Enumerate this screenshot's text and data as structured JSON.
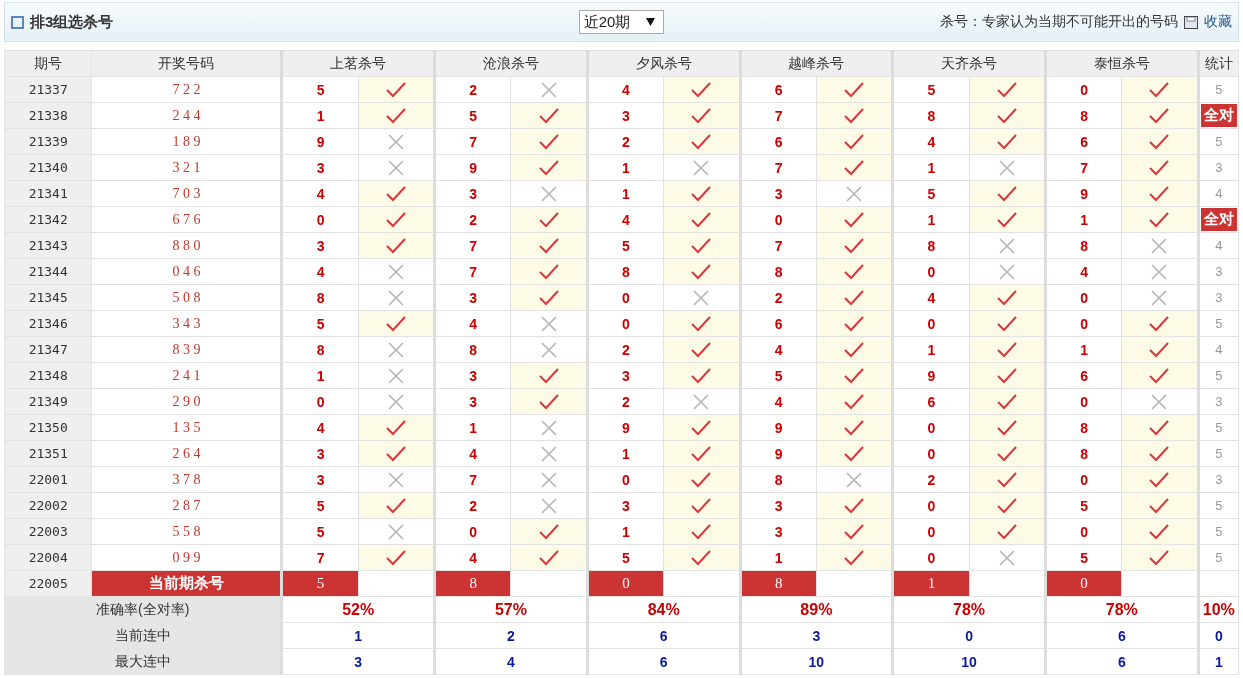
{
  "header": {
    "title": "排3组选杀号",
    "period_select": {
      "value": "近20期"
    },
    "note": "杀号：专家认为当期不可能开出的号码",
    "bookmark": "收藏"
  },
  "table": {
    "columns": [
      "期号",
      "开奖号码",
      "上茗杀号",
      "沧浪杀号",
      "夕风杀号",
      "越峰杀号",
      "天齐杀号",
      "泰恒杀号",
      "统计"
    ],
    "rows": [
      {
        "period": "21337",
        "draw": "7 2 2",
        "kills": [
          {
            "number": "5",
            "hit": true
          },
          {
            "number": "2",
            "hit": false
          },
          {
            "number": "4",
            "hit": true
          },
          {
            "number": "6",
            "hit": true
          },
          {
            "number": "5",
            "hit": true
          },
          {
            "number": "0",
            "hit": true
          }
        ],
        "stat": {
          "text": "5",
          "all_hit": false
        }
      },
      {
        "period": "21338",
        "draw": "2 4 4",
        "kills": [
          {
            "number": "1",
            "hit": true
          },
          {
            "number": "5",
            "hit": true
          },
          {
            "number": "3",
            "hit": true
          },
          {
            "number": "7",
            "hit": true
          },
          {
            "number": "8",
            "hit": true
          },
          {
            "number": "8",
            "hit": true
          }
        ],
        "stat": {
          "text": "全对",
          "all_hit": true
        }
      },
      {
        "period": "21339",
        "draw": "1 8 9",
        "kills": [
          {
            "number": "9",
            "hit": false
          },
          {
            "number": "7",
            "hit": true
          },
          {
            "number": "2",
            "hit": true
          },
          {
            "number": "6",
            "hit": true
          },
          {
            "number": "4",
            "hit": true
          },
          {
            "number": "6",
            "hit": true
          }
        ],
        "stat": {
          "text": "5",
          "all_hit": false
        }
      },
      {
        "period": "21340",
        "draw": "3 2 1",
        "kills": [
          {
            "number": "3",
            "hit": false
          },
          {
            "number": "9",
            "hit": true
          },
          {
            "number": "1",
            "hit": false
          },
          {
            "number": "7",
            "hit": true
          },
          {
            "number": "1",
            "hit": false
          },
          {
            "number": "7",
            "hit": true
          }
        ],
        "stat": {
          "text": "3",
          "all_hit": false
        }
      },
      {
        "period": "21341",
        "draw": "7 0 3",
        "kills": [
          {
            "number": "4",
            "hit": true
          },
          {
            "number": "3",
            "hit": false
          },
          {
            "number": "1",
            "hit": true
          },
          {
            "number": "3",
            "hit": false
          },
          {
            "number": "5",
            "hit": true
          },
          {
            "number": "9",
            "hit": true
          }
        ],
        "stat": {
          "text": "4",
          "all_hit": false
        }
      },
      {
        "period": "21342",
        "draw": "6 7 6",
        "kills": [
          {
            "number": "0",
            "hit": true
          },
          {
            "number": "2",
            "hit": true
          },
          {
            "number": "4",
            "hit": true
          },
          {
            "number": "0",
            "hit": true
          },
          {
            "number": "1",
            "hit": true
          },
          {
            "number": "1",
            "hit": true
          }
        ],
        "stat": {
          "text": "全对",
          "all_hit": true
        }
      },
      {
        "period": "21343",
        "draw": "8 8 0",
        "kills": [
          {
            "number": "3",
            "hit": true
          },
          {
            "number": "7",
            "hit": true
          },
          {
            "number": "5",
            "hit": true
          },
          {
            "number": "7",
            "hit": true
          },
          {
            "number": "8",
            "hit": false
          },
          {
            "number": "8",
            "hit": false
          }
        ],
        "stat": {
          "text": "4",
          "all_hit": false
        }
      },
      {
        "period": "21344",
        "draw": "0 4 6",
        "kills": [
          {
            "number": "4",
            "hit": false
          },
          {
            "number": "7",
            "hit": true
          },
          {
            "number": "8",
            "hit": true
          },
          {
            "number": "8",
            "hit": true
          },
          {
            "number": "0",
            "hit": false
          },
          {
            "number": "4",
            "hit": false
          }
        ],
        "stat": {
          "text": "3",
          "all_hit": false
        }
      },
      {
        "period": "21345",
        "draw": "5 0 8",
        "kills": [
          {
            "number": "8",
            "hit": false
          },
          {
            "number": "3",
            "hit": true
          },
          {
            "number": "0",
            "hit": false
          },
          {
            "number": "2",
            "hit": true
          },
          {
            "number": "4",
            "hit": true
          },
          {
            "number": "0",
            "hit": false
          }
        ],
        "stat": {
          "text": "3",
          "all_hit": false
        }
      },
      {
        "period": "21346",
        "draw": "3 4 3",
        "kills": [
          {
            "number": "5",
            "hit": true
          },
          {
            "number": "4",
            "hit": false
          },
          {
            "number": "0",
            "hit": true
          },
          {
            "number": "6",
            "hit": true
          },
          {
            "number": "0",
            "hit": true
          },
          {
            "number": "0",
            "hit": true
          }
        ],
        "stat": {
          "text": "5",
          "all_hit": false
        }
      },
      {
        "period": "21347",
        "draw": "8 3 9",
        "kills": [
          {
            "number": "8",
            "hit": false
          },
          {
            "number": "8",
            "hit": false
          },
          {
            "number": "2",
            "hit": true
          },
          {
            "number": "4",
            "hit": true
          },
          {
            "number": "1",
            "hit": true
          },
          {
            "number": "1",
            "hit": true
          }
        ],
        "stat": {
          "text": "4",
          "all_hit": false
        }
      },
      {
        "period": "21348",
        "draw": "2 4 1",
        "kills": [
          {
            "number": "1",
            "hit": false
          },
          {
            "number": "3",
            "hit": true
          },
          {
            "number": "3",
            "hit": true
          },
          {
            "number": "5",
            "hit": true
          },
          {
            "number": "9",
            "hit": true
          },
          {
            "number": "6",
            "hit": true
          }
        ],
        "stat": {
          "text": "5",
          "all_hit": false
        }
      },
      {
        "period": "21349",
        "draw": "2 9 0",
        "kills": [
          {
            "number": "0",
            "hit": false
          },
          {
            "number": "3",
            "hit": true
          },
          {
            "number": "2",
            "hit": false
          },
          {
            "number": "4",
            "hit": true
          },
          {
            "number": "6",
            "hit": true
          },
          {
            "number": "0",
            "hit": false
          }
        ],
        "stat": {
          "text": "3",
          "all_hit": false
        }
      },
      {
        "period": "21350",
        "draw": "1 3 5",
        "kills": [
          {
            "number": "4",
            "hit": true
          },
          {
            "number": "1",
            "hit": false
          },
          {
            "number": "9",
            "hit": true
          },
          {
            "number": "9",
            "hit": true
          },
          {
            "number": "0",
            "hit": true
          },
          {
            "number": "8",
            "hit": true
          }
        ],
        "stat": {
          "text": "5",
          "all_hit": false
        }
      },
      {
        "period": "21351",
        "draw": "2 6 4",
        "kills": [
          {
            "number": "3",
            "hit": true
          },
          {
            "number": "4",
            "hit": false
          },
          {
            "number": "1",
            "hit": true
          },
          {
            "number": "9",
            "hit": true
          },
          {
            "number": "0",
            "hit": true
          },
          {
            "number": "8",
            "hit": true
          }
        ],
        "stat": {
          "text": "5",
          "all_hit": false
        }
      },
      {
        "period": "22001",
        "draw": "3 7 8",
        "kills": [
          {
            "number": "3",
            "hit": false
          },
          {
            "number": "7",
            "hit": false
          },
          {
            "number": "0",
            "hit": true
          },
          {
            "number": "8",
            "hit": false
          },
          {
            "number": "2",
            "hit": true
          },
          {
            "number": "0",
            "hit": true
          }
        ],
        "stat": {
          "text": "3",
          "all_hit": false
        }
      },
      {
        "period": "22002",
        "draw": "2 8 7",
        "kills": [
          {
            "number": "5",
            "hit": true
          },
          {
            "number": "2",
            "hit": false
          },
          {
            "number": "3",
            "hit": true
          },
          {
            "number": "3",
            "hit": true
          },
          {
            "number": "0",
            "hit": true
          },
          {
            "number": "5",
            "hit": true
          }
        ],
        "stat": {
          "text": "5",
          "all_hit": false
        }
      },
      {
        "period": "22003",
        "draw": "5 5 8",
        "kills": [
          {
            "number": "5",
            "hit": false
          },
          {
            "number": "0",
            "hit": true
          },
          {
            "number": "1",
            "hit": true
          },
          {
            "number": "3",
            "hit": true
          },
          {
            "number": "0",
            "hit": true
          },
          {
            "number": "0",
            "hit": true
          }
        ],
        "stat": {
          "text": "5",
          "all_hit": false
        }
      },
      {
        "period": "22004",
        "draw": "0 9 9",
        "kills": [
          {
            "number": "7",
            "hit": true
          },
          {
            "number": "4",
            "hit": true
          },
          {
            "number": "5",
            "hit": true
          },
          {
            "number": "1",
            "hit": true
          },
          {
            "number": "0",
            "hit": false
          },
          {
            "number": "5",
            "hit": true
          }
        ],
        "stat": {
          "text": "5",
          "all_hit": false
        }
      }
    ],
    "current": {
      "period": "22005",
      "label": "当前期杀号",
      "kills": [
        "5",
        "8",
        "0",
        "8",
        "1",
        "0"
      ]
    },
    "summary": [
      {
        "kind": "rate",
        "label": "准确率(全对率)",
        "values": [
          "52%",
          "57%",
          "84%",
          "89%",
          "78%",
          "78%"
        ],
        "stat": "10%"
      },
      {
        "kind": "streak",
        "label": "当前连中",
        "values": [
          "1",
          "2",
          "6",
          "3",
          "0",
          "6"
        ],
        "stat": "0"
      },
      {
        "kind": "streak",
        "label": "最大连中",
        "values": [
          "3",
          "4",
          "6",
          "10",
          "10",
          "6"
        ],
        "stat": "1"
      }
    ]
  }
}
